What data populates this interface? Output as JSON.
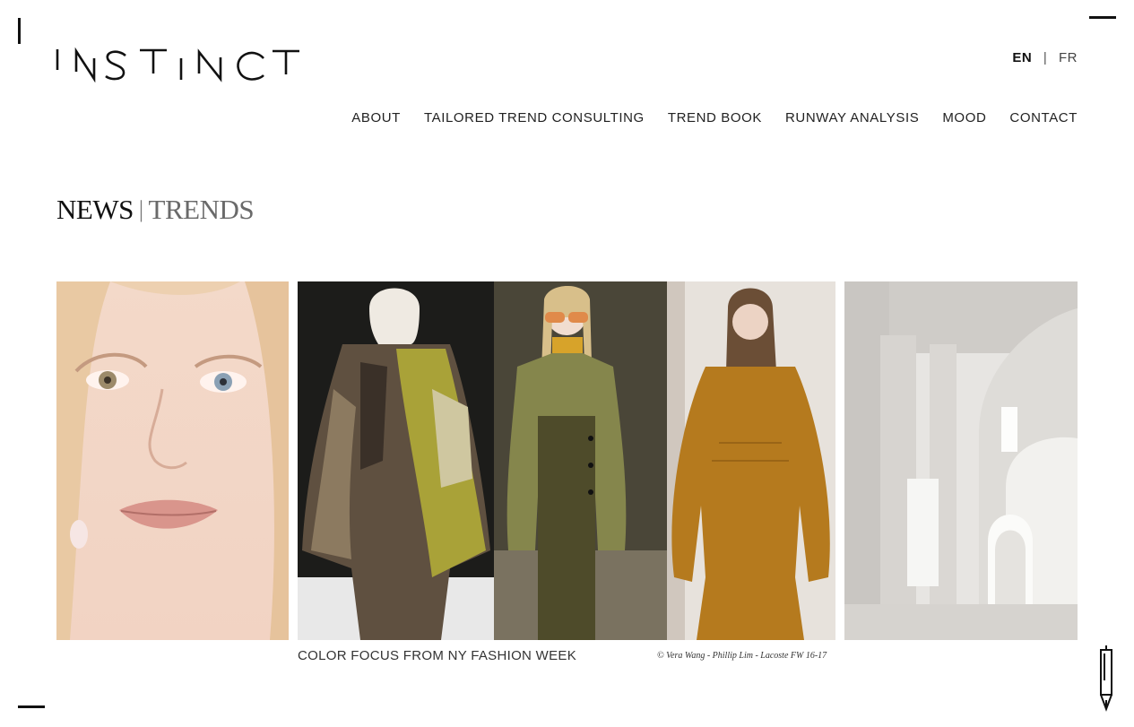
{
  "brand": {
    "logo_text": "INSTINCT"
  },
  "language": {
    "current": "EN",
    "separator": "|",
    "other": "FR"
  },
  "nav": {
    "items": [
      {
        "label": "ABOUT"
      },
      {
        "label": "TAILORED TREND CONSULTING"
      },
      {
        "label": "TREND BOOK"
      },
      {
        "label": "RUNWAY ANALYSIS"
      },
      {
        "label": "MOOD"
      },
      {
        "label": "CONTACT"
      }
    ]
  },
  "heading": {
    "news": "NEWS",
    "separator": "|",
    "trends": "TRENDS"
  },
  "gallery": {
    "items": [
      {
        "image": "close-up face portrait"
      },
      {
        "image": "runway looks: fur coat, green check jacket, mustard knit dress"
      },
      {
        "image": "white concrete arches interior"
      }
    ],
    "caption": "COLOR FOCUS FROM NY FASHION WEEK",
    "credit": "© Vera Wang - Phillip Lim - Lacoste FW 16-17"
  },
  "icons": {
    "corner_marks": "corner-mark-icon",
    "pen": "pen-icon"
  },
  "colors": {
    "background": "#ffffff",
    "text": "#111111",
    "muted": "#6a6a6a"
  }
}
